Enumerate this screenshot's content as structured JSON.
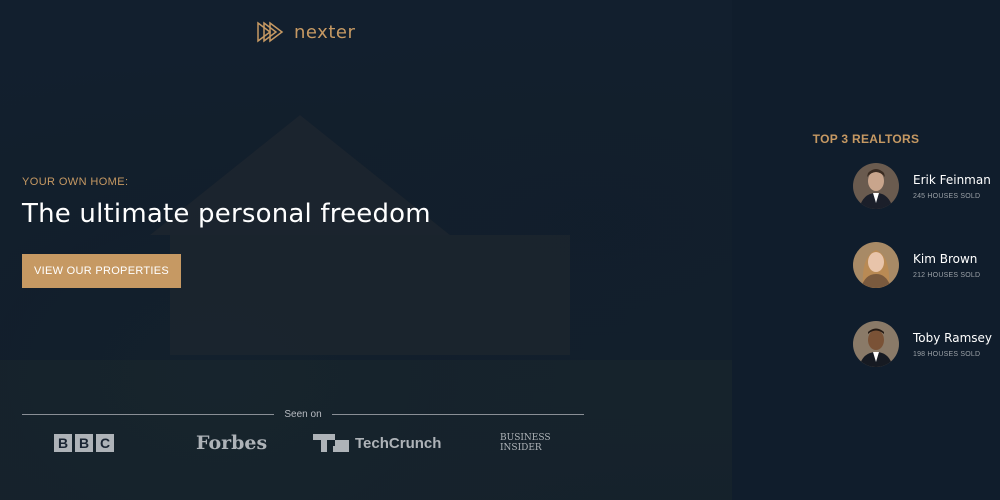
{
  "brand": {
    "name": "nexter",
    "accent": "#c69963",
    "background": "#101d2c",
    "logo_icon": "play-triangles-icon"
  },
  "hero": {
    "kicker": "YOUR OWN HOME:",
    "headline": "The ultimate personal freedom",
    "cta_label": "VIEW OUR PROPERTIES"
  },
  "seen_on": {
    "label": "Seen on",
    "logos": {
      "bbc": [
        "B",
        "B",
        "C"
      ],
      "forbes": "Forbes",
      "techcrunch": "TechCrunch",
      "business_insider": [
        "BUSINESS",
        "INSIDER"
      ]
    }
  },
  "realtors": {
    "title": "TOP 3 REALTORS",
    "items": [
      {
        "name": "Erik Feinman",
        "sold": "245 HOUSES SOLD"
      },
      {
        "name": "Kim Brown",
        "sold": "212 HOUSES SOLD"
      },
      {
        "name": "Toby Ramsey",
        "sold": "198 HOUSES SOLD"
      }
    ]
  }
}
